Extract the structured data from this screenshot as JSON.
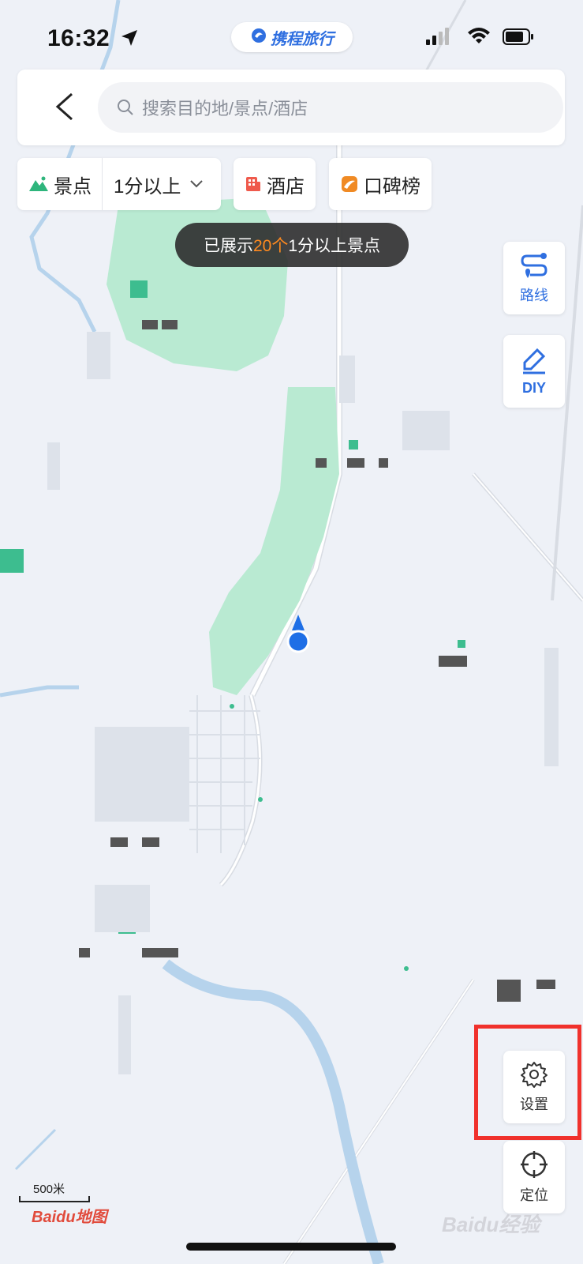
{
  "status_bar": {
    "time": "16:32"
  },
  "brand": {
    "name": "携程旅行"
  },
  "search": {
    "placeholder": "搜索目的地/景点/酒店"
  },
  "filters": {
    "sights_label": "景点",
    "rating_label": "1分以上",
    "hotel_label": "酒店",
    "ranking_label": "口碑榜"
  },
  "toast": {
    "prefix": "已展示",
    "count": "20个",
    "suffix": "1分以上景点"
  },
  "side_buttons": {
    "route_label": "路线",
    "diy_label": "DIY",
    "settings_label": "设置",
    "locate_label": "定位"
  },
  "map": {
    "scale_label": "500米",
    "provider_logo": "Baidu地图",
    "watermark": "Baidu经验"
  },
  "colors": {
    "accent": "#2f6fe0",
    "highlight": "#f0312c",
    "park_green": "#b9ead2",
    "river": "#b6d3ec",
    "toast_highlight": "#ff8a1f"
  }
}
